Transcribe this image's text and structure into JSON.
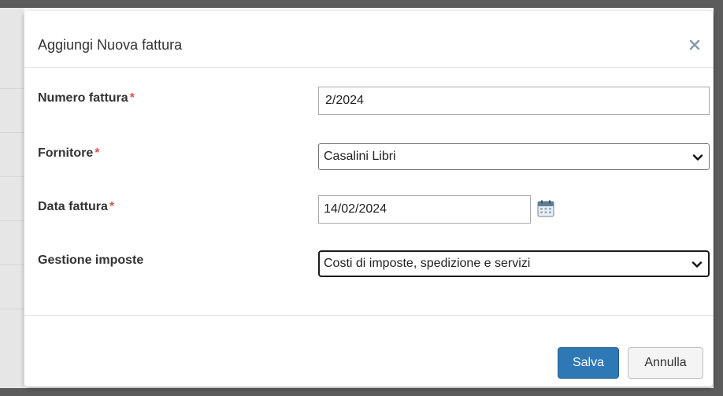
{
  "modal": {
    "title": "Aggiungi Nuova fattura",
    "close_icon": "close-icon"
  },
  "form": {
    "invoice_number": {
      "label": "Numero fattura",
      "required_mark": "*",
      "value": "2/2024"
    },
    "supplier": {
      "label": "Fornitore",
      "required_mark": "*",
      "selected": "Casalini Libri",
      "icon": "chevron-down-icon"
    },
    "invoice_date": {
      "label": "Data fattura",
      "required_mark": "*",
      "value": "14/02/2024",
      "icon": "calendar-icon"
    },
    "tax_handling": {
      "label": "Gestione imposte",
      "selected": "Costi di imposte, spedizione e servizi",
      "icon": "chevron-down-icon"
    }
  },
  "footer": {
    "save_label": "Salva",
    "cancel_label": "Annulla"
  },
  "colors": {
    "primary": "#2f78b6",
    "required": "#d9534f",
    "backdrop": "#5c5c5c"
  }
}
